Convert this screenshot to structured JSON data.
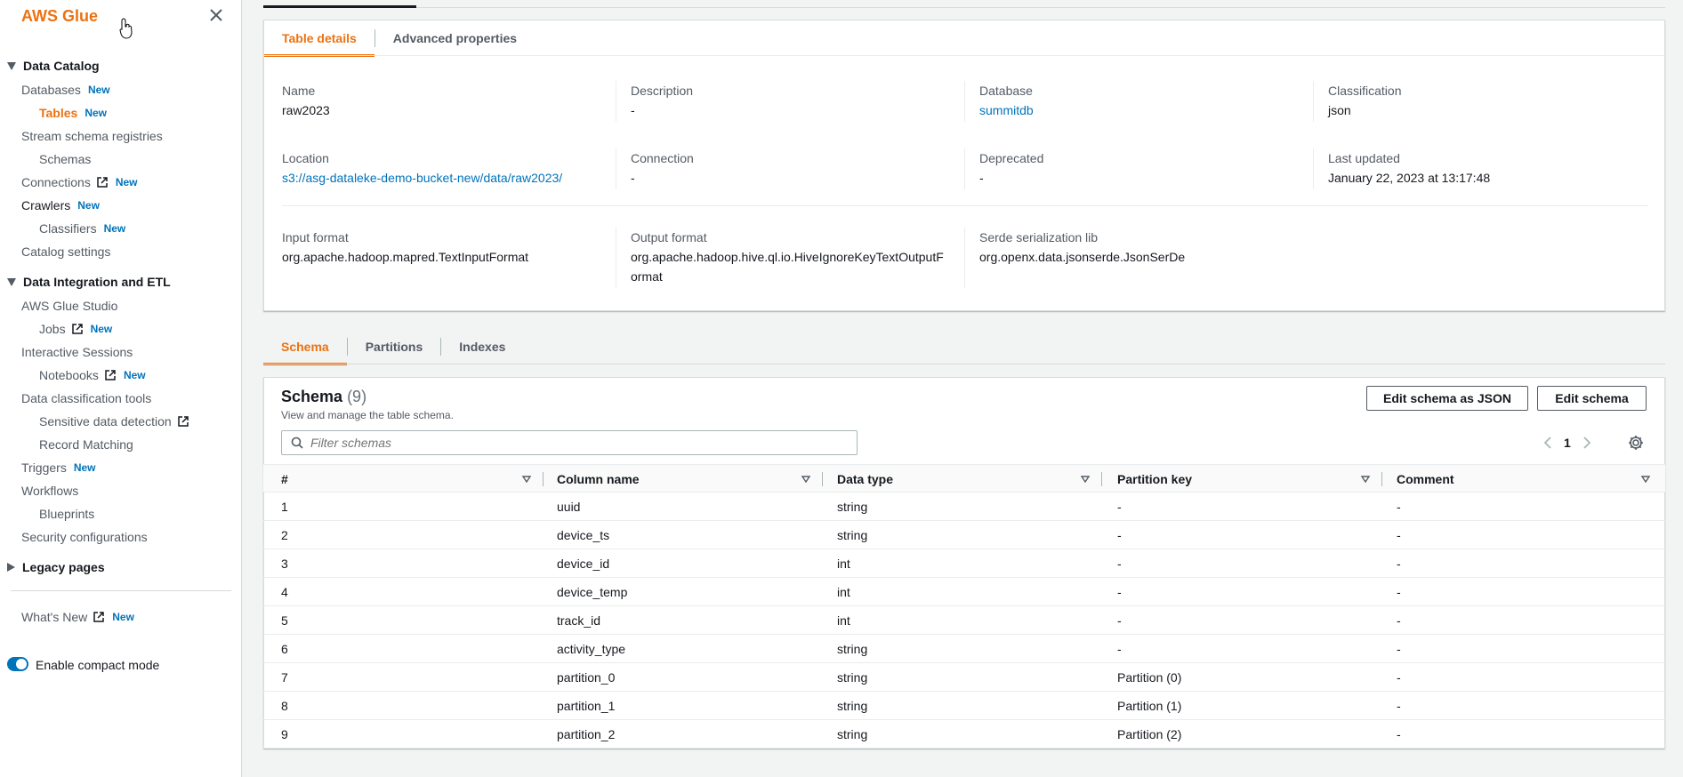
{
  "sidebar": {
    "title": "AWS Glue",
    "new_badge": "New",
    "sections": {
      "data_catalog": "Data Catalog",
      "data_integration": "Data Integration and ETL",
      "legacy": "Legacy pages"
    },
    "items": {
      "databases": "Databases",
      "tables": "Tables",
      "stream_schema_registries": "Stream schema registries",
      "schemas": "Schemas",
      "connections": "Connections",
      "crawlers": "Crawlers",
      "classifiers": "Classifiers",
      "catalog_settings": "Catalog settings",
      "glue_studio": "AWS Glue Studio",
      "jobs": "Jobs",
      "interactive_sessions": "Interactive Sessions",
      "notebooks": "Notebooks",
      "data_classification_tools": "Data classification tools",
      "sensitive_data_detection": "Sensitive data detection",
      "record_matching": "Record Matching",
      "triggers": "Triggers",
      "workflows": "Workflows",
      "blueprints": "Blueprints",
      "security_configurations": "Security configurations",
      "whats_new": "What's New"
    },
    "compact_mode_label": "Enable compact mode"
  },
  "details": {
    "tabs": [
      "Table details",
      "Advanced properties"
    ],
    "name_label": "Name",
    "name_value": "raw2023",
    "description_label": "Description",
    "description_value": "-",
    "database_label": "Database",
    "database_value": "summitdb",
    "classification_label": "Classification",
    "classification_value": "json",
    "location_label": "Location",
    "location_value": "s3://asg-dataleke-demo-bucket-new/data/raw2023/",
    "connection_label": "Connection",
    "connection_value": "-",
    "deprecated_label": "Deprecated",
    "deprecated_value": "-",
    "last_updated_label": "Last updated",
    "last_updated_value": "January 22, 2023 at 13:17:48",
    "input_format_label": "Input format",
    "input_format_value": "org.apache.hadoop.mapred.TextInputFormat",
    "output_format_label": "Output format",
    "output_format_value_1": "org.apache.hadoop.hive.ql.io.HiveIgnoreKeyTextOutputF",
    "output_format_value_2": "ormat",
    "serde_label": "Serde serialization lib",
    "serde_value": "org.openx.data.jsonserde.JsonSerDe"
  },
  "schema_tabs": [
    "Schema",
    "Partitions",
    "Indexes"
  ],
  "schema": {
    "title": "Schema",
    "count": "(9)",
    "description": "View and manage the table schema.",
    "edit_json_label": "Edit schema as JSON",
    "edit_label": "Edit schema",
    "filter_placeholder": "Filter schemas",
    "page": "1",
    "columns": [
      "#",
      "Column name",
      "Data type",
      "Partition key",
      "Comment"
    ],
    "rows": [
      [
        "1",
        "uuid",
        "string",
        "-",
        "-"
      ],
      [
        "2",
        "device_ts",
        "string",
        "-",
        "-"
      ],
      [
        "3",
        "device_id",
        "int",
        "-",
        "-"
      ],
      [
        "4",
        "device_temp",
        "int",
        "-",
        "-"
      ],
      [
        "5",
        "track_id",
        "int",
        "-",
        "-"
      ],
      [
        "6",
        "activity_type",
        "string",
        "-",
        "-"
      ],
      [
        "7",
        "partition_0",
        "string",
        "Partition (0)",
        "-"
      ],
      [
        "8",
        "partition_1",
        "string",
        "Partition (1)",
        "-"
      ],
      [
        "9",
        "partition_2",
        "string",
        "Partition (2)",
        "-"
      ]
    ]
  }
}
